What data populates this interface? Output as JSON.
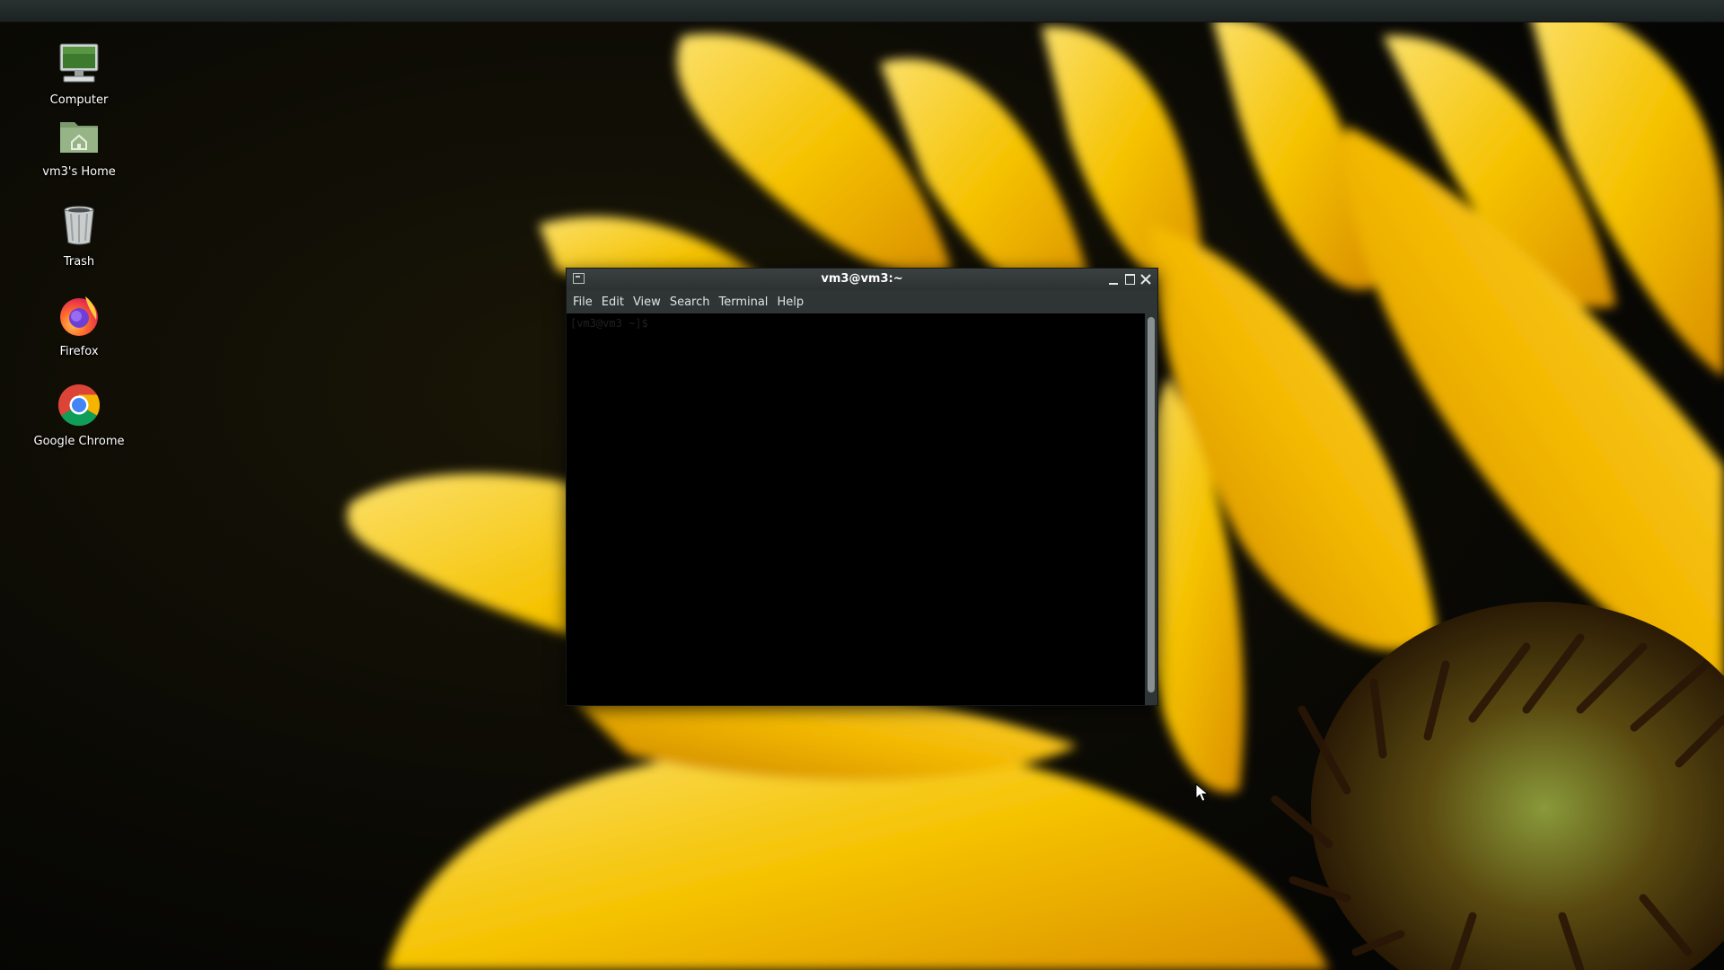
{
  "desktop": {
    "icons": [
      {
        "label": "Computer",
        "icon": "computer-icon"
      },
      {
        "label": "vm3's Home",
        "icon": "home-folder-icon"
      },
      {
        "label": "Trash",
        "icon": "trash-icon"
      },
      {
        "label": "Firefox",
        "icon": "firefox-icon"
      },
      {
        "label": "Google Chrome",
        "icon": "chrome-icon"
      }
    ]
  },
  "terminal": {
    "title": "vm3@vm3:~",
    "menu": [
      "File",
      "Edit",
      "View",
      "Search",
      "Terminal",
      "Help"
    ],
    "prompt": "[vm3@vm3 ~]$"
  },
  "colors": {
    "panel": "#1f2626",
    "window_chrome": "#2f3434",
    "terminal_bg": "#000000",
    "petal": "#f6c400",
    "wallpaper_dark": "#0b0a05"
  }
}
